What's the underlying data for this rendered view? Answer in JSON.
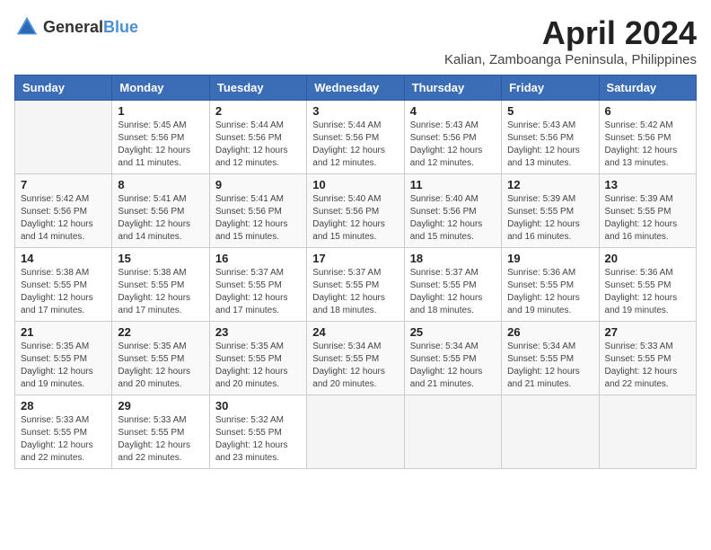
{
  "header": {
    "logo_general": "General",
    "logo_blue": "Blue",
    "month_title": "April 2024",
    "location": "Kalian, Zamboanga Peninsula, Philippines"
  },
  "weekdays": [
    "Sunday",
    "Monday",
    "Tuesday",
    "Wednesday",
    "Thursday",
    "Friday",
    "Saturday"
  ],
  "weeks": [
    [
      {
        "day": "",
        "sunrise": "",
        "sunset": "",
        "daylight": ""
      },
      {
        "day": "1",
        "sunrise": "Sunrise: 5:45 AM",
        "sunset": "Sunset: 5:56 PM",
        "daylight": "Daylight: 12 hours and 11 minutes."
      },
      {
        "day": "2",
        "sunrise": "Sunrise: 5:44 AM",
        "sunset": "Sunset: 5:56 PM",
        "daylight": "Daylight: 12 hours and 12 minutes."
      },
      {
        "day": "3",
        "sunrise": "Sunrise: 5:44 AM",
        "sunset": "Sunset: 5:56 PM",
        "daylight": "Daylight: 12 hours and 12 minutes."
      },
      {
        "day": "4",
        "sunrise": "Sunrise: 5:43 AM",
        "sunset": "Sunset: 5:56 PM",
        "daylight": "Daylight: 12 hours and 12 minutes."
      },
      {
        "day": "5",
        "sunrise": "Sunrise: 5:43 AM",
        "sunset": "Sunset: 5:56 PM",
        "daylight": "Daylight: 12 hours and 13 minutes."
      },
      {
        "day": "6",
        "sunrise": "Sunrise: 5:42 AM",
        "sunset": "Sunset: 5:56 PM",
        "daylight": "Daylight: 12 hours and 13 minutes."
      }
    ],
    [
      {
        "day": "7",
        "sunrise": "Sunrise: 5:42 AM",
        "sunset": "Sunset: 5:56 PM",
        "daylight": "Daylight: 12 hours and 14 minutes."
      },
      {
        "day": "8",
        "sunrise": "Sunrise: 5:41 AM",
        "sunset": "Sunset: 5:56 PM",
        "daylight": "Daylight: 12 hours and 14 minutes."
      },
      {
        "day": "9",
        "sunrise": "Sunrise: 5:41 AM",
        "sunset": "Sunset: 5:56 PM",
        "daylight": "Daylight: 12 hours and 15 minutes."
      },
      {
        "day": "10",
        "sunrise": "Sunrise: 5:40 AM",
        "sunset": "Sunset: 5:56 PM",
        "daylight": "Daylight: 12 hours and 15 minutes."
      },
      {
        "day": "11",
        "sunrise": "Sunrise: 5:40 AM",
        "sunset": "Sunset: 5:56 PM",
        "daylight": "Daylight: 12 hours and 15 minutes."
      },
      {
        "day": "12",
        "sunrise": "Sunrise: 5:39 AM",
        "sunset": "Sunset: 5:55 PM",
        "daylight": "Daylight: 12 hours and 16 minutes."
      },
      {
        "day": "13",
        "sunrise": "Sunrise: 5:39 AM",
        "sunset": "Sunset: 5:55 PM",
        "daylight": "Daylight: 12 hours and 16 minutes."
      }
    ],
    [
      {
        "day": "14",
        "sunrise": "Sunrise: 5:38 AM",
        "sunset": "Sunset: 5:55 PM",
        "daylight": "Daylight: 12 hours and 17 minutes."
      },
      {
        "day": "15",
        "sunrise": "Sunrise: 5:38 AM",
        "sunset": "Sunset: 5:55 PM",
        "daylight": "Daylight: 12 hours and 17 minutes."
      },
      {
        "day": "16",
        "sunrise": "Sunrise: 5:37 AM",
        "sunset": "Sunset: 5:55 PM",
        "daylight": "Daylight: 12 hours and 17 minutes."
      },
      {
        "day": "17",
        "sunrise": "Sunrise: 5:37 AM",
        "sunset": "Sunset: 5:55 PM",
        "daylight": "Daylight: 12 hours and 18 minutes."
      },
      {
        "day": "18",
        "sunrise": "Sunrise: 5:37 AM",
        "sunset": "Sunset: 5:55 PM",
        "daylight": "Daylight: 12 hours and 18 minutes."
      },
      {
        "day": "19",
        "sunrise": "Sunrise: 5:36 AM",
        "sunset": "Sunset: 5:55 PM",
        "daylight": "Daylight: 12 hours and 19 minutes."
      },
      {
        "day": "20",
        "sunrise": "Sunrise: 5:36 AM",
        "sunset": "Sunset: 5:55 PM",
        "daylight": "Daylight: 12 hours and 19 minutes."
      }
    ],
    [
      {
        "day": "21",
        "sunrise": "Sunrise: 5:35 AM",
        "sunset": "Sunset: 5:55 PM",
        "daylight": "Daylight: 12 hours and 19 minutes."
      },
      {
        "day": "22",
        "sunrise": "Sunrise: 5:35 AM",
        "sunset": "Sunset: 5:55 PM",
        "daylight": "Daylight: 12 hours and 20 minutes."
      },
      {
        "day": "23",
        "sunrise": "Sunrise: 5:35 AM",
        "sunset": "Sunset: 5:55 PM",
        "daylight": "Daylight: 12 hours and 20 minutes."
      },
      {
        "day": "24",
        "sunrise": "Sunrise: 5:34 AM",
        "sunset": "Sunset: 5:55 PM",
        "daylight": "Daylight: 12 hours and 20 minutes."
      },
      {
        "day": "25",
        "sunrise": "Sunrise: 5:34 AM",
        "sunset": "Sunset: 5:55 PM",
        "daylight": "Daylight: 12 hours and 21 minutes."
      },
      {
        "day": "26",
        "sunrise": "Sunrise: 5:34 AM",
        "sunset": "Sunset: 5:55 PM",
        "daylight": "Daylight: 12 hours and 21 minutes."
      },
      {
        "day": "27",
        "sunrise": "Sunrise: 5:33 AM",
        "sunset": "Sunset: 5:55 PM",
        "daylight": "Daylight: 12 hours and 22 minutes."
      }
    ],
    [
      {
        "day": "28",
        "sunrise": "Sunrise: 5:33 AM",
        "sunset": "Sunset: 5:55 PM",
        "daylight": "Daylight: 12 hours and 22 minutes."
      },
      {
        "day": "29",
        "sunrise": "Sunrise: 5:33 AM",
        "sunset": "Sunset: 5:55 PM",
        "daylight": "Daylight: 12 hours and 22 minutes."
      },
      {
        "day": "30",
        "sunrise": "Sunrise: 5:32 AM",
        "sunset": "Sunset: 5:55 PM",
        "daylight": "Daylight: 12 hours and 23 minutes."
      },
      {
        "day": "",
        "sunrise": "",
        "sunset": "",
        "daylight": ""
      },
      {
        "day": "",
        "sunrise": "",
        "sunset": "",
        "daylight": ""
      },
      {
        "day": "",
        "sunrise": "",
        "sunset": "",
        "daylight": ""
      },
      {
        "day": "",
        "sunrise": "",
        "sunset": "",
        "daylight": ""
      }
    ]
  ]
}
